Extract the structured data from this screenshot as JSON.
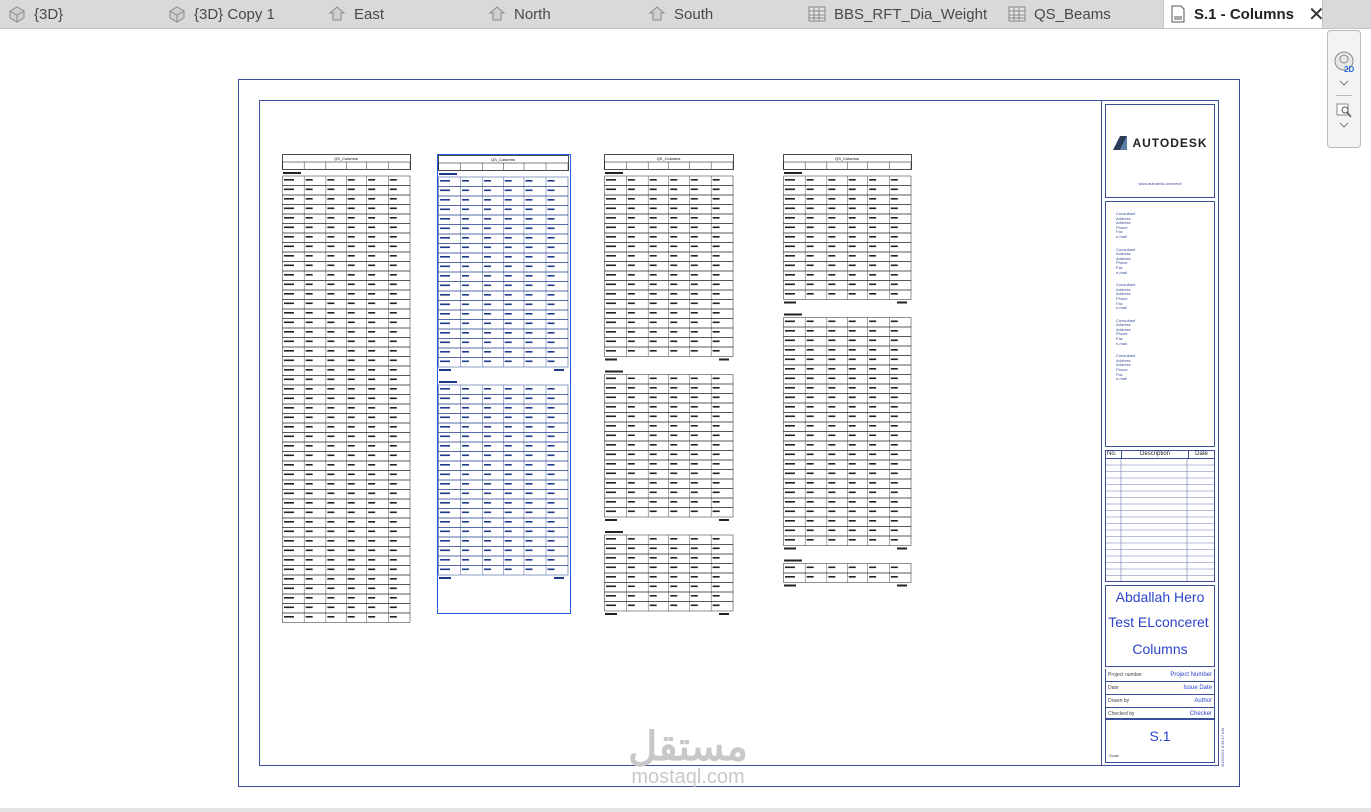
{
  "tabs": [
    {
      "label": "{3D}",
      "icon": "3d-view-icon"
    },
    {
      "label": "{3D} Copy 1",
      "icon": "3d-view-icon"
    },
    {
      "label": "East",
      "icon": "elevation-icon"
    },
    {
      "label": "North",
      "icon": "elevation-icon"
    },
    {
      "label": "South",
      "icon": "elevation-icon"
    },
    {
      "label": "BBS_RFT_Dia_Weight",
      "icon": "schedule-icon"
    },
    {
      "label": "QS_Beams",
      "icon": "schedule-icon"
    },
    {
      "label": "S.1 - Columns",
      "icon": "sheet-icon",
      "active": true
    }
  ],
  "navbar": {
    "label_2d": "2D"
  },
  "titleblock": {
    "logo": "AUTODESK",
    "url": "www.autodesk.com/revit",
    "consultants": [
      "Consultant",
      "Address",
      "Address",
      "Phone",
      "Fax",
      "e-mail"
    ],
    "revision_headers": {
      "no": "No.",
      "description": "Description",
      "date": "Date"
    },
    "owner": "Abdallah Hero",
    "project": "Test ELconceret",
    "sheet_name": "Columns",
    "props": [
      {
        "k": "Project number",
        "v": "Project Number"
      },
      {
        "k": "Date",
        "v": "Issue Date"
      },
      {
        "k": "Drawn by",
        "v": "Author"
      },
      {
        "k": "Checked by",
        "v": "Checker"
      }
    ],
    "sheet_number": "S.1",
    "scale_label": "Scale",
    "vertical_text": "3/16/2021 6:39:17 AM"
  },
  "schedules": [
    {
      "title": "QS_Columns"
    },
    {
      "title": "QS_Columns"
    },
    {
      "title": "QS_Columns"
    },
    {
      "title": "QS_Columns"
    }
  ],
  "watermark": {
    "arabic": "مستقل",
    "latin": "mostaql.com"
  }
}
